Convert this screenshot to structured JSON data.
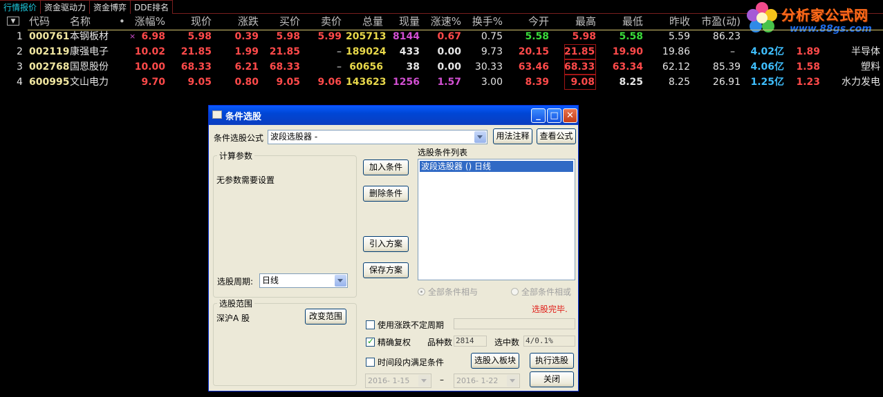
{
  "tabs": [
    "行情报价",
    "资金驱动力",
    "资金博弈",
    "DDE排名"
  ],
  "logo": {
    "name": "分析家公式网",
    "url": "www.88gs.com"
  },
  "table": {
    "headers": [
      "代码",
      "名称",
      "•",
      "涨幅%",
      "现价",
      "涨跌",
      "买价",
      "卖价",
      "总量",
      "现量",
      "涨速%",
      "换手%",
      "今开",
      "最高",
      "最低",
      "昨收",
      "市盈(动)"
    ],
    "rows": [
      {
        "idx": "1",
        "code": "000761",
        "name": "本钢板材",
        "mark": "×",
        "pct": "6.98",
        "price": "5.98",
        "chg": "0.39",
        "bid": "5.98",
        "ask": "5.99",
        "vol": "205713",
        "cur": "8144",
        "speed": "0.67",
        "turn": "0.75",
        "open": "5.58",
        "high": "5.98",
        "low": "5.58",
        "prev": "5.59",
        "pe": "86.23",
        "amt": "",
        "ratio": "",
        "ind": ""
      },
      {
        "idx": "2",
        "code": "002119",
        "name": "康强电子",
        "mark": "",
        "pct": "10.02",
        "price": "21.85",
        "chg": "1.99",
        "bid": "21.85",
        "ask": "–",
        "vol": "189024",
        "cur": "433",
        "speed": "0.00",
        "turn": "9.73",
        "open": "20.15",
        "high": "21.85",
        "low": "19.90",
        "prev": "19.86",
        "pe": "–",
        "amt": "4.02亿",
        "ratio": "1.89",
        "ind": "半导体"
      },
      {
        "idx": "3",
        "code": "002768",
        "name": "国恩股份",
        "mark": "",
        "pct": "10.00",
        "price": "68.33",
        "chg": "6.21",
        "bid": "68.33",
        "ask": "–",
        "vol": "60656",
        "cur": "38",
        "speed": "0.00",
        "turn": "30.33",
        "open": "63.46",
        "high": "68.33",
        "low": "63.34",
        "prev": "62.12",
        "pe": "85.39",
        "amt": "4.06亿",
        "ratio": "1.58",
        "ind": "塑料"
      },
      {
        "idx": "4",
        "code": "600995",
        "name": "文山电力",
        "mark": "",
        "pct": "9.70",
        "price": "9.05",
        "chg": "0.80",
        "bid": "9.05",
        "ask": "9.06",
        "vol": "143623",
        "cur": "1256",
        "speed": "1.57",
        "turn": "3.00",
        "open": "8.39",
        "high": "9.08",
        "low": "8.25",
        "prev": "8.25",
        "pe": "26.91",
        "amt": "1.25亿",
        "ratio": "1.23",
        "ind": "水力发电"
      }
    ]
  },
  "dialog": {
    "title": "条件选股",
    "formula_label": "条件选股公式",
    "formula_value": "波段选股器  -",
    "usage_button": "用法注释",
    "view_formula_button": "查看公式",
    "params_group": "计算参数",
    "no_params": "无参数需要设置",
    "conditions_list_label": "选股条件列表",
    "conditions": [
      "波段选股器  ()  日线"
    ],
    "add_condition": "加入条件",
    "delete_condition": "删除条件",
    "import_plan": "引入方案",
    "save_plan": "保存方案",
    "period_label": "选股周期:",
    "period_value": "日线",
    "radio_and": "全部条件相与",
    "radio_or": "全部条件相或",
    "status": "选股完毕.",
    "range_group": "选股范围",
    "range_value": "深沪A 股",
    "change_range": "改变范围",
    "use_irregular_period": "使用涨跌不定周期",
    "exact_adjust": "精确复权",
    "species_label": "品种数",
    "species_value": "2814",
    "selected_label": "选中数",
    "selected_value": "4/0.1%",
    "time_condition": "时间段内满足条件",
    "to_block": "选股入板块",
    "run_select": "执行选股",
    "close": "关闭",
    "date_from": "2016- 1-15",
    "date_sep": "–",
    "date_to": "2016- 1-22"
  }
}
